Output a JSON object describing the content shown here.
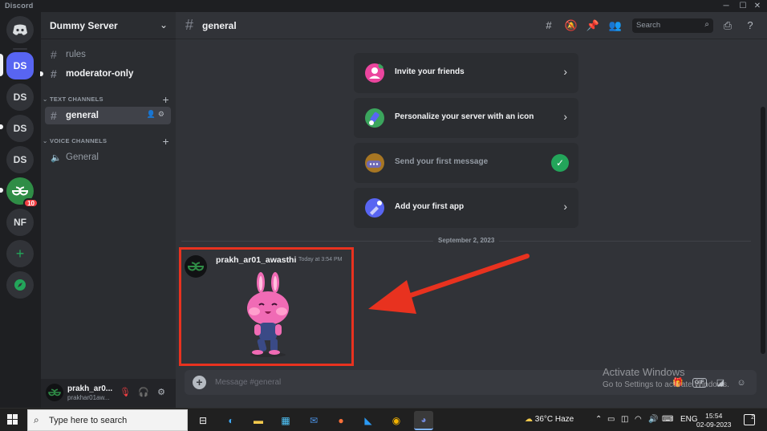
{
  "window": {
    "title": "Discord",
    "controls": [
      "minimize",
      "maximize",
      "close"
    ]
  },
  "servers": [
    {
      "label": "",
      "icon": "discord-home-icon",
      "selected": false
    },
    {
      "label": "DS",
      "selected": true
    },
    {
      "label": "DS",
      "selected": false
    },
    {
      "label": "DS",
      "selected": false,
      "unread": true
    },
    {
      "label": "DS",
      "selected": false
    },
    {
      "label": "",
      "icon": "geeksforgeeks-logo",
      "badge": "10",
      "unread": true
    },
    {
      "label": "NF",
      "selected": false
    },
    {
      "label": "",
      "icon": "add-server-icon"
    },
    {
      "label": "",
      "icon": "explore-compass-icon"
    }
  ],
  "sidebar": {
    "server_name": "Dummy Server",
    "channels_top": [
      {
        "name": "rules",
        "icon": "hash-icon"
      },
      {
        "name": "moderator-only",
        "icon": "hash-lock-icon",
        "bold": true
      }
    ],
    "text_category": "TEXT CHANNELS",
    "text_channels": [
      {
        "name": "general",
        "selected": true
      }
    ],
    "voice_category": "VOICE CHANNELS",
    "voice_channels": [
      {
        "name": "General",
        "icon": "speaker-icon"
      }
    ]
  },
  "user": {
    "name": "prakh_ar0...",
    "tag": "prakhar01aw..."
  },
  "channel_header": {
    "name": "general",
    "search_placeholder": "Search"
  },
  "welcome_cards": [
    {
      "label": "Invite your friends",
      "status": "todo",
      "color": "#eb459e"
    },
    {
      "label": "Personalize your server with an icon",
      "status": "todo",
      "color": "#3ba55d"
    },
    {
      "label": "Send your first message",
      "status": "done",
      "color": "#faa61a"
    },
    {
      "label": "Add your first app",
      "status": "todo",
      "color": "#5865f2"
    }
  ],
  "date_divider": "September 2, 2023",
  "message": {
    "author": "prakh_ar01_awasthi",
    "timestamp": "Today at 3:54 PM",
    "attachment": "pink-bunny-sticker"
  },
  "composer": {
    "placeholder": "Message #general"
  },
  "watermark": {
    "line1": "Activate Windows",
    "line2": "Go to Settings to activate Windows."
  },
  "taskbar": {
    "search_placeholder": "Type here to search",
    "weather": "36°C  Haze",
    "language": "ENG",
    "time": "15:54",
    "date": "02-09-2023",
    "notifications": "2"
  },
  "colors": {
    "accent": "#5865f2",
    "highlight_box": "#e8321f",
    "success": "#23a55a"
  }
}
